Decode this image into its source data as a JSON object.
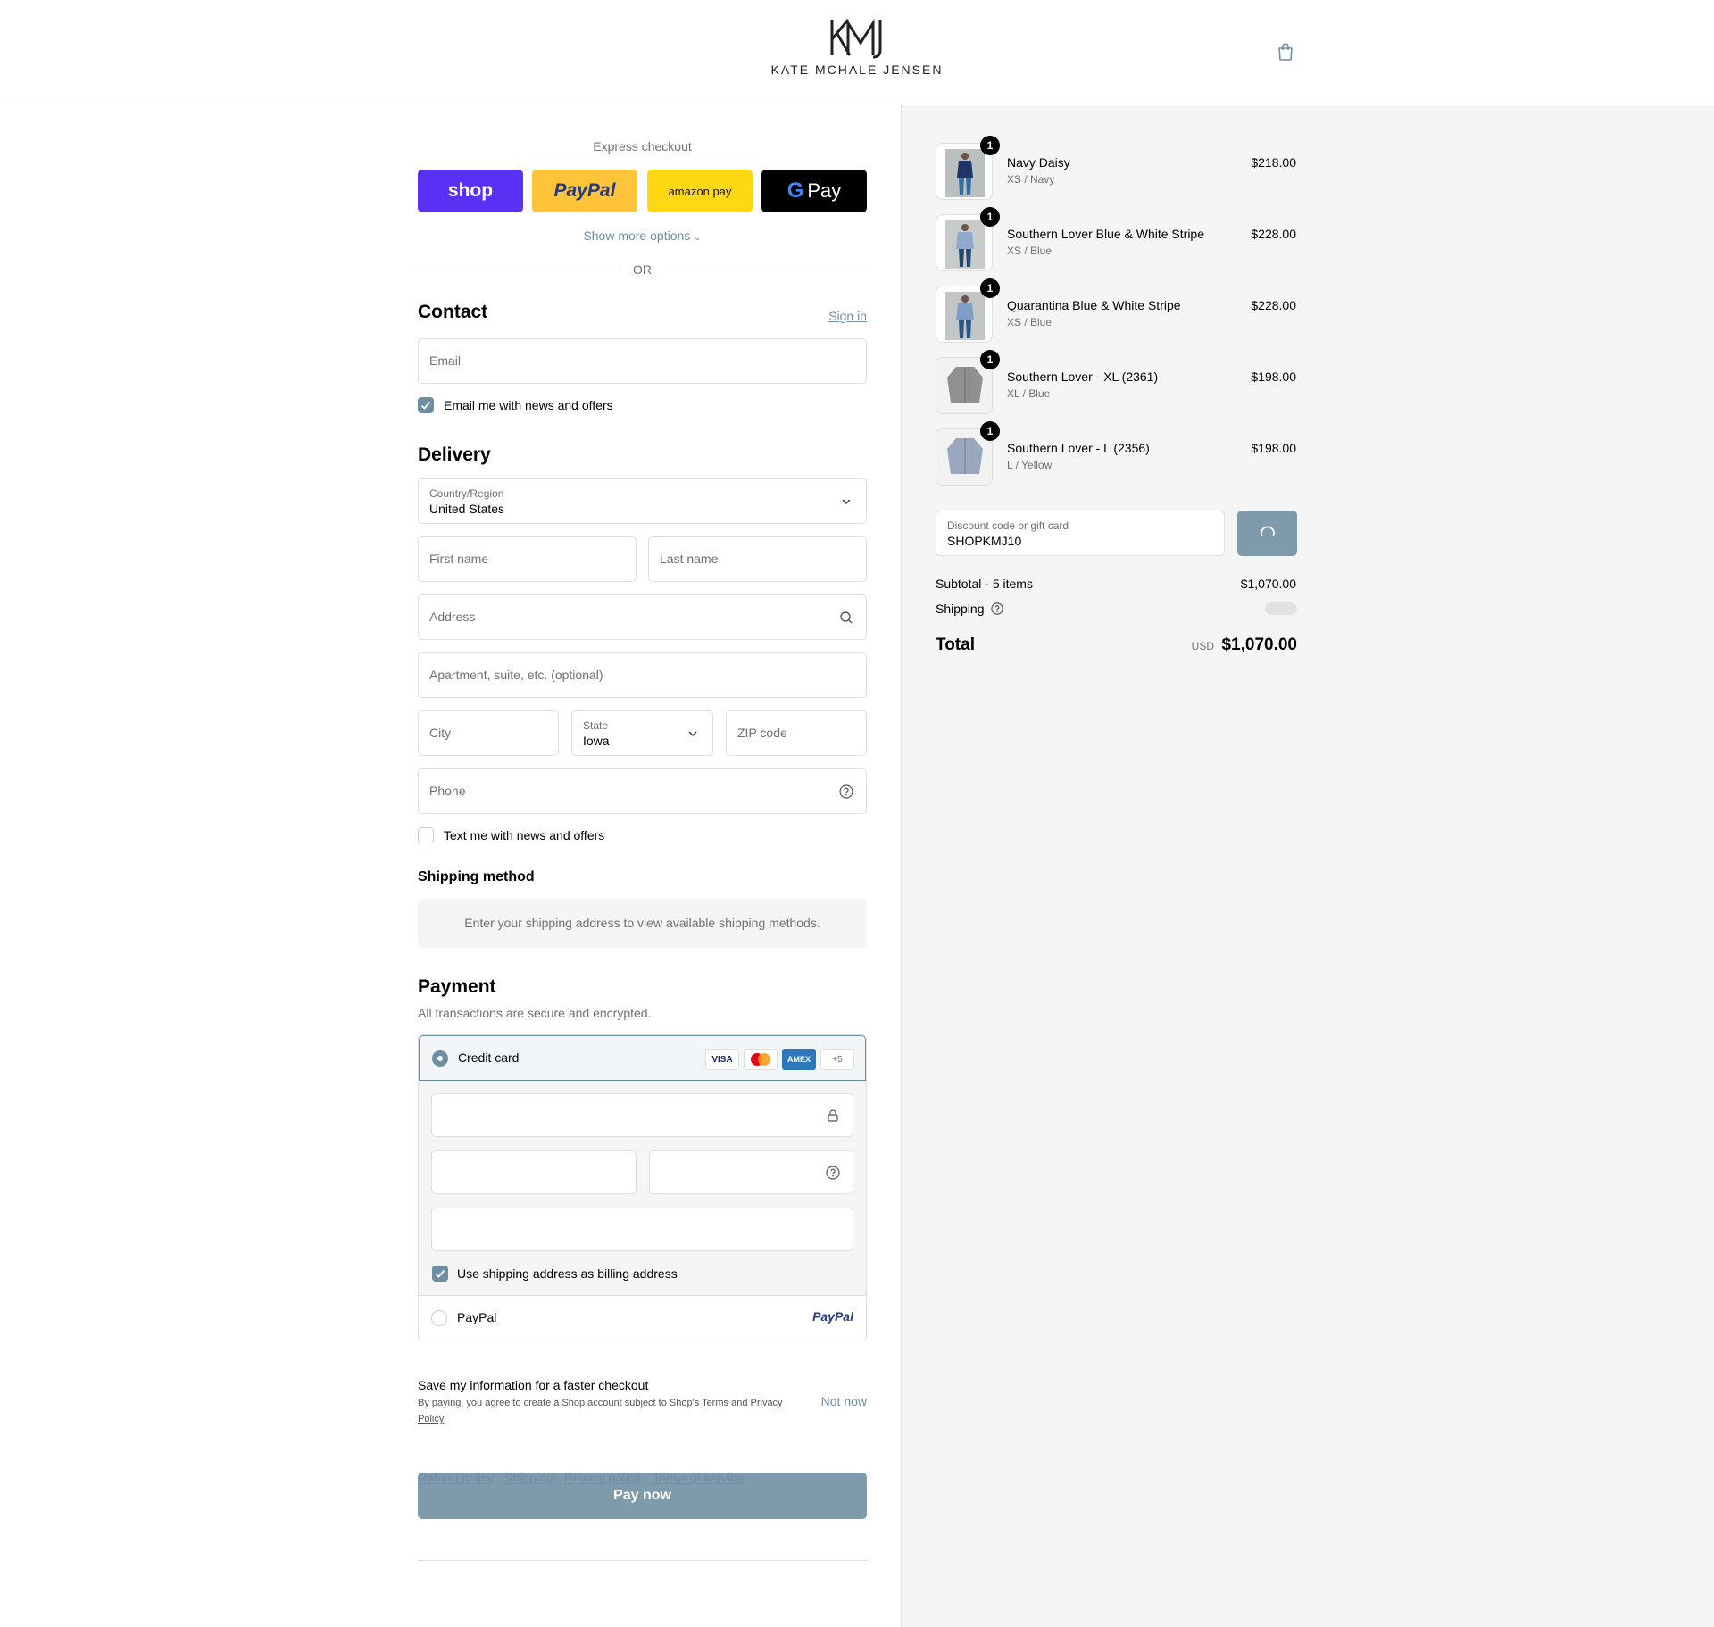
{
  "header": {
    "brand_monogram": "KMJ",
    "brand_name": "KATE MCHALE JENSEN"
  },
  "express": {
    "title": "Express checkout",
    "buttons": {
      "shop": "shop",
      "paypal": "PayPal",
      "amazon": "amazon pay",
      "gpay": "Pay"
    },
    "show_more": "Show more options",
    "or": "OR"
  },
  "contact": {
    "heading": "Contact",
    "sign_in": "Sign in",
    "email_placeholder": "Email",
    "news_label": "Email me with news and offers"
  },
  "delivery": {
    "heading": "Delivery",
    "country_label": "Country/Region",
    "country_value": "United States",
    "first_name": "First name",
    "last_name": "Last name",
    "address": "Address",
    "apartment": "Apartment, suite, etc. (optional)",
    "city": "City",
    "state_label": "State",
    "state_value": "Iowa",
    "zip": "ZIP code",
    "phone": "Phone",
    "text_label": "Text me with news and offers"
  },
  "shipping_method": {
    "heading": "Shipping method",
    "message": "Enter your shipping address to view available shipping methods."
  },
  "payment": {
    "heading": "Payment",
    "subheading": "All transactions are secure and encrypted.",
    "credit_card": "Credit card",
    "card_logos": [
      "VISA",
      "",
      "AMEX",
      "+5"
    ],
    "billing_label": "Use shipping address as billing address",
    "paypal": "PayPal",
    "paypal_logo": "PayPal"
  },
  "save_info": {
    "title": "Save my information for a faster checkout",
    "desc_prefix": "By paying, you agree to create a Shop account subject to Shop's",
    "terms": "Terms",
    "and": "and",
    "privacy": "Privacy Policy",
    "not_now": "Not now"
  },
  "pay_now": "Pay now",
  "footer": {
    "links": [
      "Refund policy",
      "Shipping",
      "Privacy policy",
      "Terms of service"
    ]
  },
  "cart": {
    "items": [
      {
        "name": "Navy Daisy",
        "variant": "XS / Navy",
        "price": "$218.00",
        "qty": "1"
      },
      {
        "name": "Southern Lover Blue & White Stripe",
        "variant": "XS / Blue",
        "price": "$228.00",
        "qty": "1"
      },
      {
        "name": "Quarantina Blue & White Stripe",
        "variant": "XS / Blue",
        "price": "$228.00",
        "qty": "1"
      },
      {
        "name": "Southern Lover - XL (2361)",
        "variant": "XL / Blue",
        "price": "$198.00",
        "qty": "1"
      },
      {
        "name": "Southern Lover - L (2356)",
        "variant": "L / Yellow",
        "price": "$198.00",
        "qty": "1"
      }
    ],
    "discount_label": "Discount code or gift card",
    "discount_value": "SHOPKMJ10",
    "subtotal_label": "Subtotal · 5 items",
    "subtotal_value": "$1,070.00",
    "shipping_label": "Shipping",
    "total_label": "Total",
    "currency": "USD",
    "total_value": "$1,070.00"
  },
  "colors": {
    "accent": "#6e8fa3",
    "shop": "#5a31f4",
    "paypal": "#ffc439",
    "amazon": "#ffd814",
    "gpay": "#000000"
  }
}
